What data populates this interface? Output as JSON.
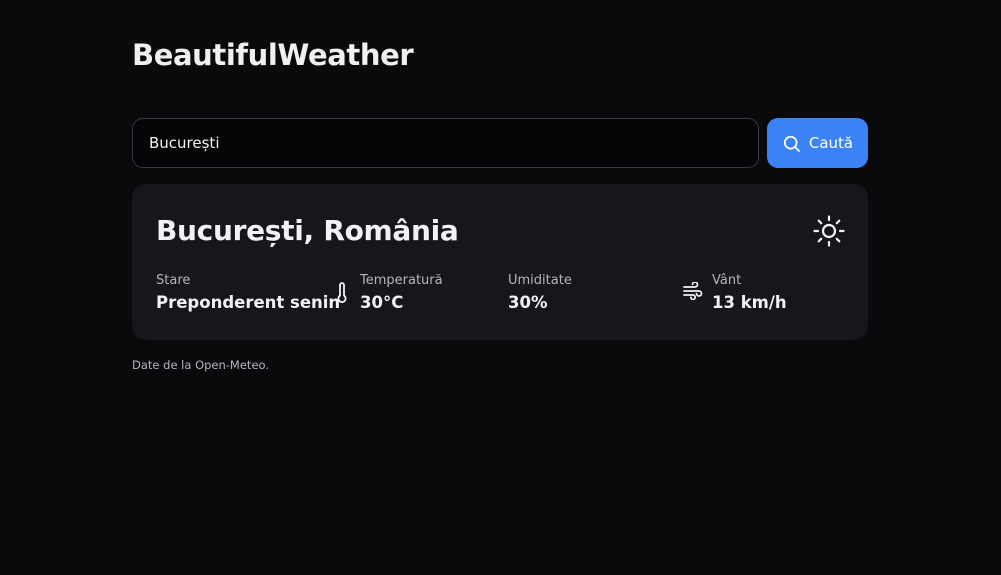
{
  "app": {
    "title": "BeautifulWeather"
  },
  "search": {
    "value": "București",
    "button_label": "Caută",
    "button_icon": "search-icon",
    "accent_color": "#3b82f6"
  },
  "weather": {
    "location": "București, România",
    "condition_icon": "sun-icon",
    "stats": [
      {
        "label": "Stare",
        "value": "Preponderent senin",
        "icon": ""
      },
      {
        "label": "Temperatură",
        "value": "30°C",
        "icon": "thermometer-icon"
      },
      {
        "label": "Umiditate",
        "value": "30%",
        "icon": ""
      },
      {
        "label": "Vânt",
        "value": "13 km/h",
        "icon": "wind-icon"
      }
    ]
  },
  "footer": {
    "note": "Date de la Open-Meteo."
  },
  "colors": {
    "background": "#0a0a0c",
    "card": "#17171b",
    "text": "#f2f2f4",
    "muted_text": "#b4b4bc"
  }
}
